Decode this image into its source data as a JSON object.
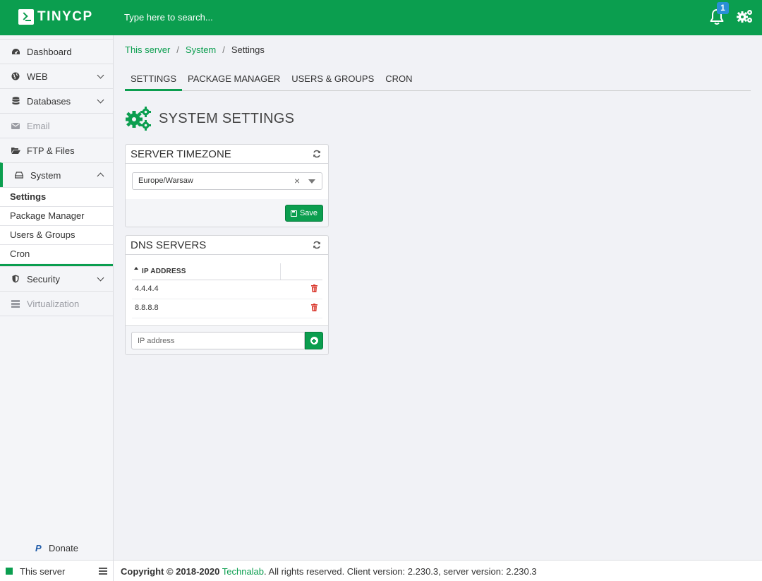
{
  "app": {
    "logo_text": "TINYCP",
    "search_placeholder": "Type here to search...",
    "notification_count": "1",
    "brand_color": "#0b9e4f"
  },
  "sidebar": {
    "items": [
      {
        "label": "Dashboard",
        "icon": "dashboard-icon"
      },
      {
        "label": "WEB",
        "icon": "globe-icon"
      },
      {
        "label": "Databases",
        "icon": "database-icon"
      },
      {
        "label": "Email",
        "icon": "envelope-icon"
      },
      {
        "label": "FTP & Files",
        "icon": "folder-open-icon"
      },
      {
        "label": "System",
        "icon": "hdd-icon"
      },
      {
        "label": "Security",
        "icon": "shield-icon"
      },
      {
        "label": "Virtualization",
        "icon": "server-icon"
      }
    ],
    "system_subitems": [
      "Settings",
      "Package Manager",
      "Users & Groups",
      "Cron"
    ],
    "donate_label": "Donate"
  },
  "breadcrumb": {
    "items": [
      "This server",
      "System",
      "Settings"
    ],
    "separator": "/"
  },
  "tabs": [
    "SETTINGS",
    "PACKAGE MANAGER",
    "USERS & GROUPS",
    "CRON"
  ],
  "page_title": "SYSTEM SETTINGS",
  "timezone_panel": {
    "title": "SERVER TIMEZONE",
    "selected": "Europe/Warsaw",
    "clear_glyph": "×",
    "save_label": "Save"
  },
  "dns_panel": {
    "title": "DNS SERVERS",
    "column_header": "IP ADDRESS",
    "rows": [
      "4.4.4.4",
      "8.8.8.8"
    ],
    "input_placeholder": "IP address"
  },
  "footer": {
    "server_name": "This server",
    "copyright_prefix": "Copyright © 2018-2020",
    "company": "Technalab",
    "copyright_suffix": ". All rights reserved. Client version: 2.230.3, server version: 2.230.3"
  }
}
